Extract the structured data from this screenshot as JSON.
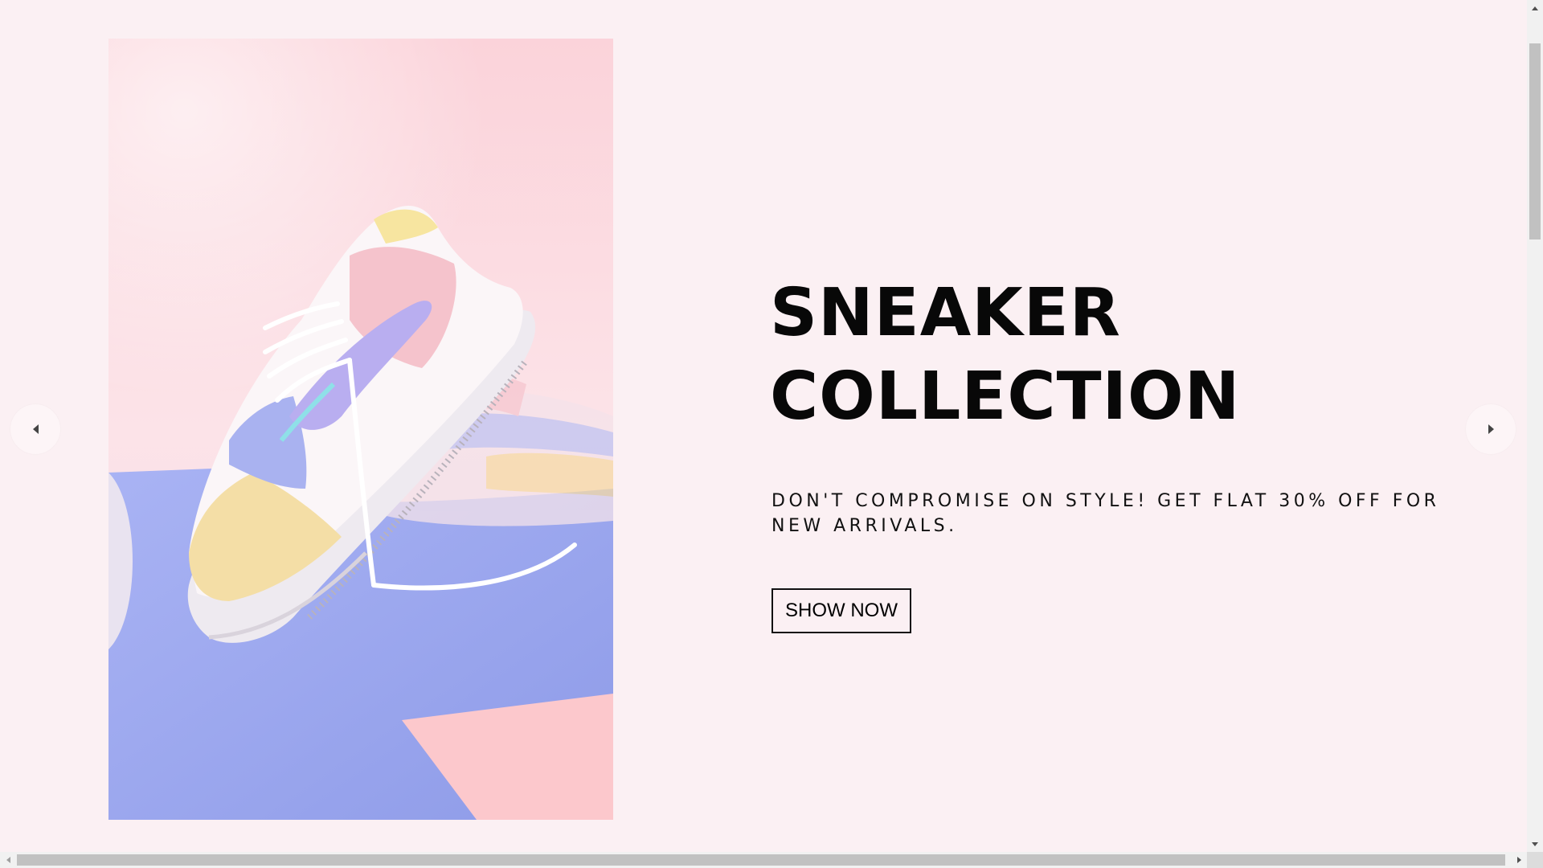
{
  "hero": {
    "image_alt": "Pastel sneaker",
    "title_line1": "SNEAKER",
    "title_line2": "COLLECTION",
    "subtitle": "DON'T COMPROMISE ON STYLE! GET FLAT 30% OFF FOR NEW ARRIVALS.",
    "cta_label": "SHOW NOW"
  },
  "carousel": {
    "prev_icon": "caret-left-icon",
    "next_icon": "caret-right-icon"
  },
  "colors": {
    "page_background": "#fbf0f3",
    "text": "#080808",
    "image_pink": "#fbd6dc",
    "image_blue": "#9aa6ee"
  }
}
